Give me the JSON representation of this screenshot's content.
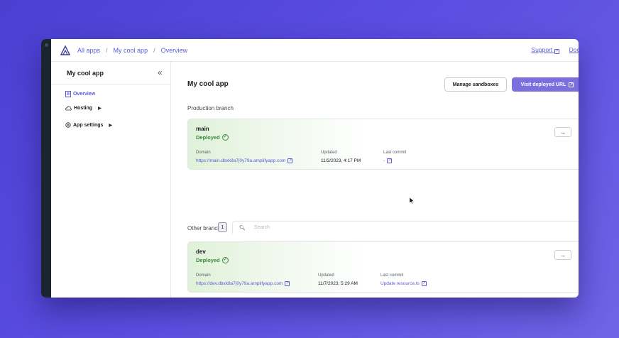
{
  "breadcrumb": [
    "All apps",
    "My cool app",
    "Overview"
  ],
  "top_links": [
    "Support",
    "Docs"
  ],
  "sidebar": {
    "title": "My cool app",
    "items": [
      {
        "label": "Overview",
        "icon": "document-icon"
      },
      {
        "label": "Hosting",
        "icon": "cloud-icon"
      },
      {
        "label": "App settings",
        "icon": "gear-icon"
      }
    ]
  },
  "page_title": "My cool app",
  "buttons": {
    "manage": "Manage sandboxes",
    "visit": "Visit deployed URL"
  },
  "production": {
    "label": "Production branch",
    "branch": "main",
    "status": "Deployed",
    "domain_label": "Domain",
    "domain": "https://main.dbxk8a7j0y79a.amplifyapp.com",
    "updated_label": "Updated",
    "updated": "11/2/2023, 4:17 PM",
    "commit_label": "Last commit",
    "commit": "-"
  },
  "other": {
    "label": "Other branches",
    "count": "1",
    "search_placeholder": "Search",
    "branch": "dev",
    "status": "Deployed",
    "domain_label": "Domain",
    "domain": "https://dev.dbxk8a7j0y79a.amplifyapp.com",
    "updated_label": "Updated",
    "updated": "11/7/2023, 5:29 AM",
    "commit_label": "Last commit",
    "commit": "Update resource.ts"
  },
  "colors": {
    "accent": "#5b5bd6",
    "primary_button": "#7b6fe0",
    "deployed": "#3a8a3a"
  }
}
